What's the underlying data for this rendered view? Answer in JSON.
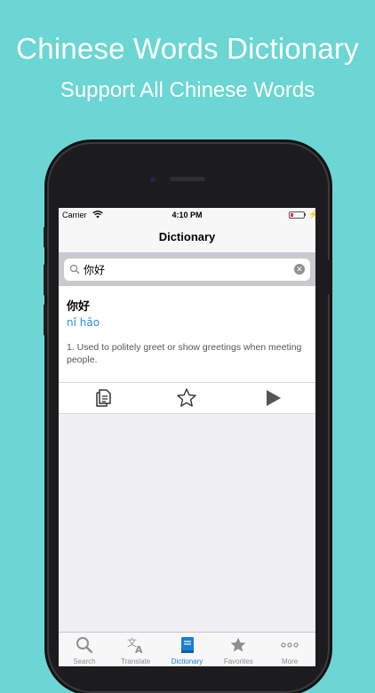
{
  "promo": {
    "title": "Chinese Words Dictionary",
    "subtitle": "Support All Chinese Words"
  },
  "status_bar": {
    "carrier": "Carrier",
    "time": "4:10 PM"
  },
  "navbar": {
    "title": "Dictionary"
  },
  "search": {
    "value": "你好",
    "clear_icon": "clear-icon"
  },
  "result": {
    "word": "你好",
    "pinyin": "nǐ hǎo",
    "definition": "1. Used to politely greet or show greetings when meeting people."
  },
  "actions": [
    {
      "icon": "copy-icon"
    },
    {
      "icon": "star-outline-icon"
    },
    {
      "icon": "play-icon"
    }
  ],
  "tabbar": {
    "items": [
      {
        "label": "Search",
        "icon": "search-icon"
      },
      {
        "label": "Translate",
        "icon": "translate-icon"
      },
      {
        "label": "Dictionary",
        "icon": "book-icon",
        "active": true
      },
      {
        "label": "Favorites",
        "icon": "star-icon"
      },
      {
        "label": "More",
        "icon": "more-icon"
      }
    ]
  },
  "colors": {
    "background": "#6bd6d3",
    "accent": "#1a7ed6",
    "pinyin": "#2a8fd8",
    "battery_low": "#e23b2e"
  }
}
